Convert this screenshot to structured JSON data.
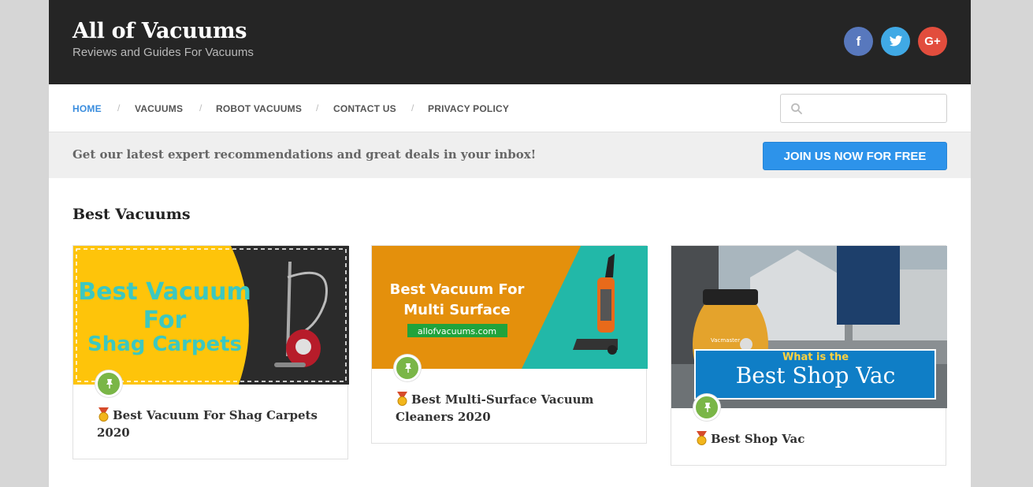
{
  "header": {
    "site_title": "All of Vacuums",
    "tagline": "Reviews and Guides For Vacuums",
    "social": {
      "facebook": "f",
      "twitter": "twitter-icon",
      "google_plus": "G+"
    }
  },
  "nav": {
    "items": [
      "HOME",
      "VACUUMS",
      "ROBOT VACUUMS",
      "CONTACT US",
      "PRIVACY POLICY"
    ],
    "separator": "/",
    "search_placeholder": ""
  },
  "newsletter": {
    "text": "Get our latest expert recommendations and great deals in your inbox!",
    "button": "JOIN US NOW FOR FREE"
  },
  "section": {
    "title": "Best Vacuums"
  },
  "cards": [
    {
      "title": "Best Vacuum For Shag Carpets 2020",
      "image_text": [
        "Best Vacuum",
        "For",
        "Shag Carpets"
      ]
    },
    {
      "title": "Best Multi-Surface Vacuum Cleaners 2020",
      "image_text": [
        "Best Vacuum For",
        "Multi Surface",
        "allofvacuums.com"
      ]
    },
    {
      "title": "Best Shop Vac",
      "image_text": [
        "What is the",
        "Best Shop Vac",
        "Vacmaster"
      ]
    }
  ],
  "colors": {
    "accent": "#2d93ea",
    "pin": "#7ab647",
    "header_bg": "#252525"
  },
  "icons": {
    "pin": "pin-icon",
    "search": "search-icon",
    "medal": "medal-icon"
  }
}
